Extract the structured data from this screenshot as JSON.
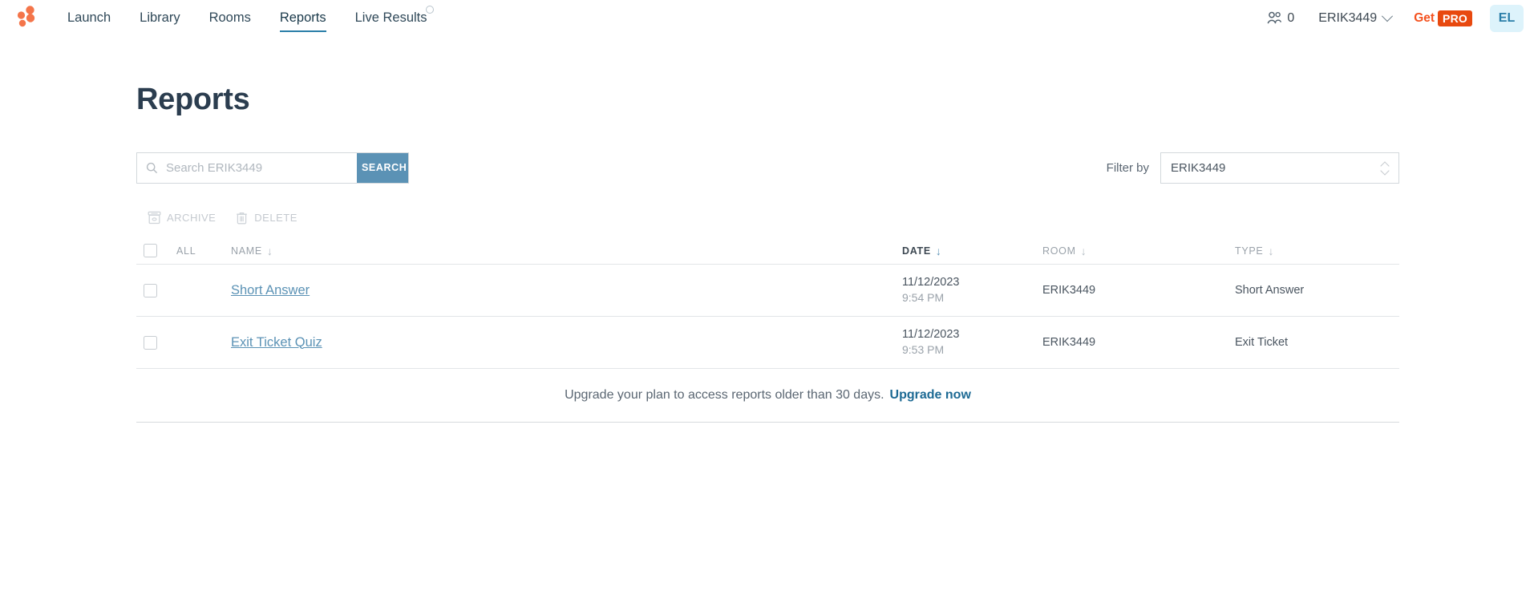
{
  "nav": {
    "logo_name": "brand-dots-logo",
    "items": [
      {
        "label": "Launch",
        "active": false,
        "badge": false
      },
      {
        "label": "Library",
        "active": false,
        "badge": false
      },
      {
        "label": "Rooms",
        "active": false,
        "badge": false
      },
      {
        "label": "Reports",
        "active": true,
        "badge": false
      },
      {
        "label": "Live Results",
        "active": false,
        "badge": true
      }
    ],
    "people_count": "0",
    "account_name": "ERIK3449",
    "get_label": "Get",
    "pro_label": "PRO",
    "avatar_initials": "EL"
  },
  "page": {
    "title": "Reports"
  },
  "search": {
    "placeholder": "Search ERIK3449",
    "value": "",
    "button_label": "SEARCH"
  },
  "filter": {
    "label": "Filter by",
    "selected": "ERIK3449"
  },
  "toolbar": {
    "archive_label": "ARCHIVE",
    "delete_label": "DELETE"
  },
  "table": {
    "select_all_label": "ALL",
    "columns": {
      "name": "NAME",
      "date": "DATE",
      "room": "ROOM",
      "type": "TYPE"
    },
    "rows": [
      {
        "name": "Short Answer",
        "date": "11/12/2023",
        "time": "9:54 PM",
        "room": "ERIK3449",
        "type": "Short Answer"
      },
      {
        "name": "Exit Ticket Quiz",
        "date": "11/12/2023",
        "time": "9:53 PM",
        "room": "ERIK3449",
        "type": "Exit Ticket"
      }
    ]
  },
  "upgrade": {
    "text": "Upgrade your plan to access reports older than 30 days.",
    "link_label": "Upgrade now"
  },
  "colors": {
    "accent_blue": "#5b92b5",
    "link_blue": "#1d6a94",
    "brand_orange": "#f4511e",
    "pro_badge": "#e8490f",
    "avatar_bg": "#ddf3fb",
    "title_dark": "#2b3d4f"
  }
}
